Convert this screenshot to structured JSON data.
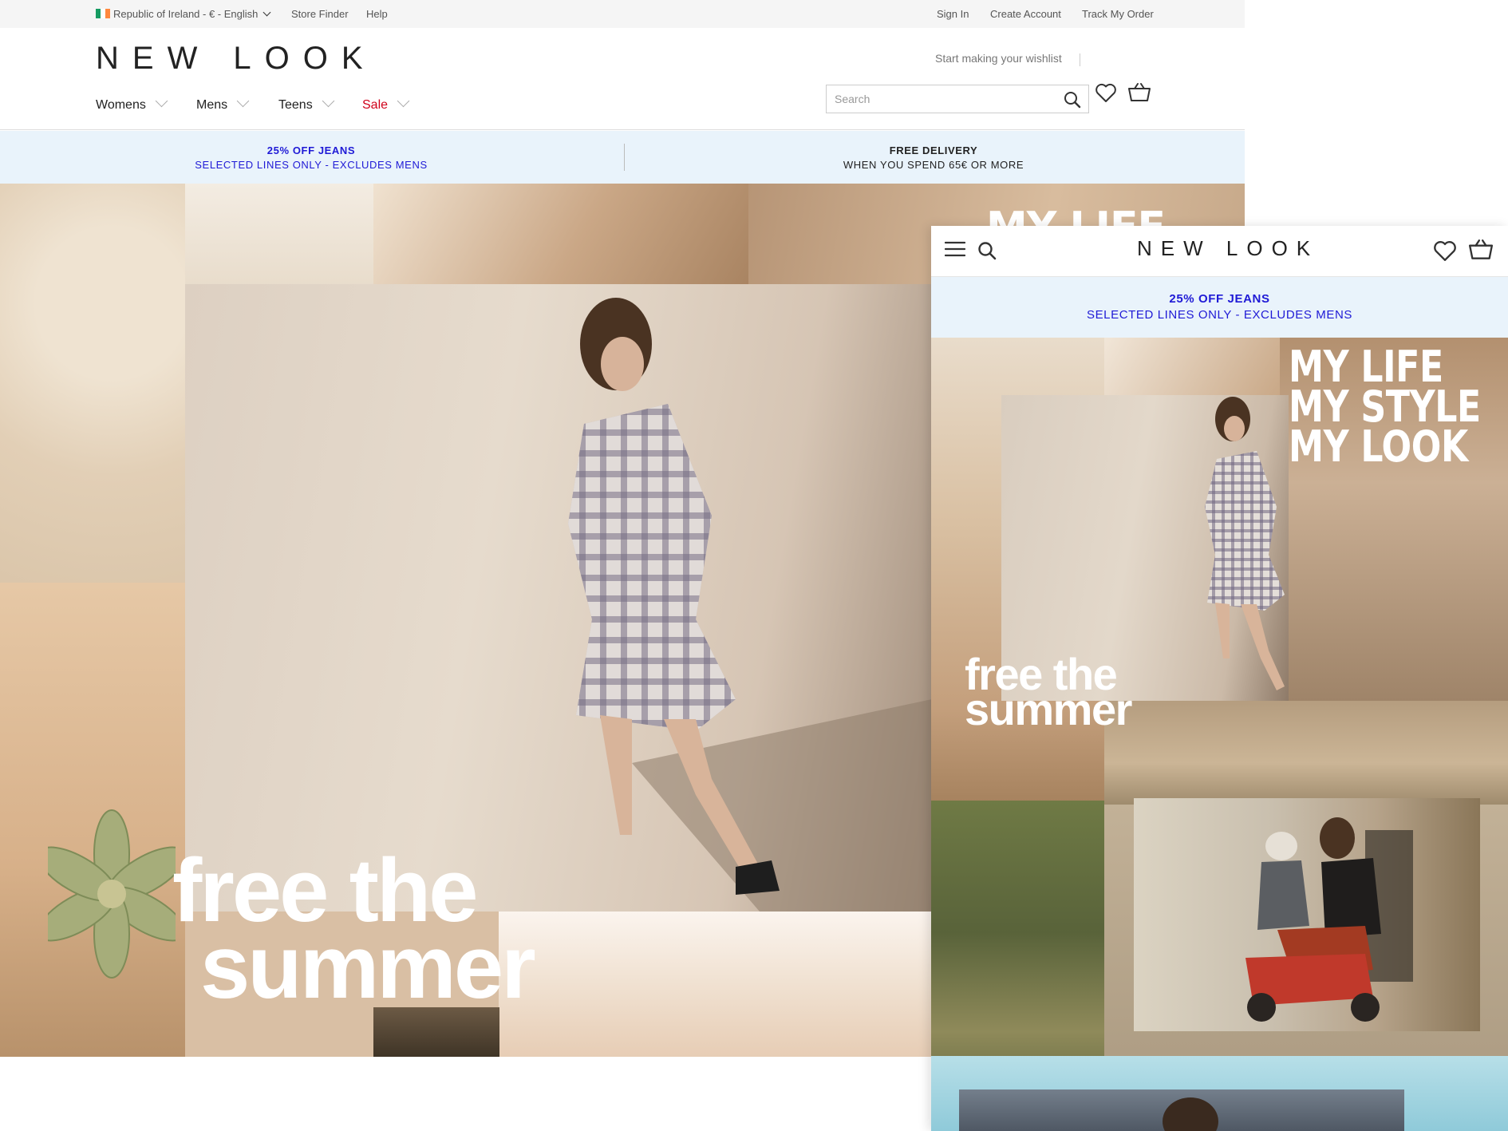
{
  "colors": {
    "promo_blue": "#1f1ad6",
    "sale_red": "#d0021b",
    "text_dark": "#222222",
    "promo_bg": "#e9f3fb",
    "utility_bg": "#f5f5f5"
  },
  "desktop": {
    "utility": {
      "region": "Republic of Ireland - € - English",
      "store_finder": "Store Finder",
      "help": "Help",
      "sign_in": "Sign In",
      "create_account": "Create Account",
      "track_order": "Track My Order"
    },
    "logo": "NEW LOOK",
    "wishlist_prompt": "Start making your wishlist",
    "nav": [
      {
        "label": "Womens"
      },
      {
        "label": "Mens"
      },
      {
        "label": "Teens"
      },
      {
        "label": "Sale"
      }
    ],
    "search": {
      "placeholder": "Search"
    },
    "icons": [
      "search-icon",
      "heart-icon",
      "basket-icon",
      "chevron-down-icon",
      "ireland-flag-icon"
    ],
    "promos": [
      {
        "title": "25% OFF JEANS",
        "subtitle": "SELECTED LINES ONLY - EXCLUDES MENS"
      },
      {
        "title": "FREE DELIVERY",
        "subtitle": "WHEN YOU SPEND 65€ OR MORE"
      }
    ],
    "hero": {
      "line1": "free the",
      "line2": "summer",
      "peek_text": "MY LIFE"
    }
  },
  "mobile": {
    "logo": "NEW LOOK",
    "icons": [
      "menu-icon",
      "search-icon",
      "heart-icon",
      "basket-icon"
    ],
    "promo": {
      "title": "25% OFF JEANS",
      "subtitle": "SELECTED LINES ONLY - EXCLUDES MENS"
    },
    "hero": {
      "tagline": [
        "MY LIFE",
        "MY STYLE",
        "MY LOOK"
      ],
      "line1": "free the",
      "line2": "summer"
    }
  }
}
